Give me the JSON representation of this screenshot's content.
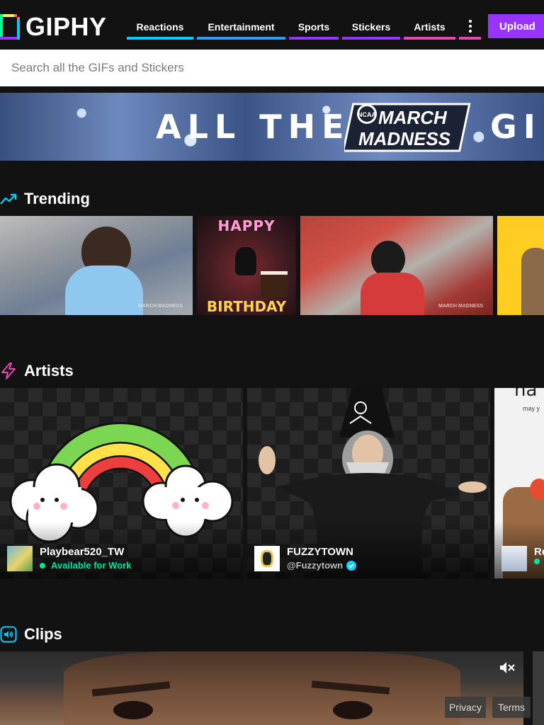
{
  "header": {
    "logo_text": "GIPHY",
    "nav": [
      {
        "label": "Reactions",
        "color": "#00ccff"
      },
      {
        "label": "Entertainment",
        "color": "#3399ff"
      },
      {
        "label": "Sports",
        "color": "#9933ff"
      },
      {
        "label": "Stickers",
        "color": "#9933ff"
      },
      {
        "label": "Artists",
        "color": "#e646b6"
      }
    ],
    "more_icon": "vertical-dots-icon",
    "upload_label": "Upload"
  },
  "search": {
    "placeholder": "Search all the GIFs and Stickers"
  },
  "banner": {
    "text_left": "ALL THE",
    "logo_line1": "MARCH",
    "logo_line2": "MADNESS",
    "logo_badge": "NCAA",
    "text_right": "GIFS"
  },
  "trending": {
    "title": "Trending",
    "icon": "trending-up-icon",
    "gifs": [
      {
        "caption": "",
        "watermark": "MARCH MADNESS"
      },
      {
        "caption_top": "HAPPY",
        "caption_bottom": "BIRTHDAY"
      },
      {
        "caption": "",
        "watermark": "MARCH MADNESS"
      },
      {
        "caption": ""
      }
    ]
  },
  "artists": {
    "title": "Artists",
    "icon": "lightning-icon",
    "cards": [
      {
        "name": "Playbear520_TW",
        "status": "Available for Work",
        "status_color": "#00e6a0"
      },
      {
        "name": "FUZZYTOWN",
        "handle": "@Fuzzytown",
        "verified": true
      },
      {
        "name": "Re",
        "card_text_top": "ha",
        "card_text_sub": "may y"
      }
    ]
  },
  "clips": {
    "title": "Clips",
    "icon": "speaker-icon",
    "mute_icon": "muted-speaker-icon"
  },
  "footer": {
    "privacy_label": "Privacy",
    "terms_label": "Terms"
  }
}
